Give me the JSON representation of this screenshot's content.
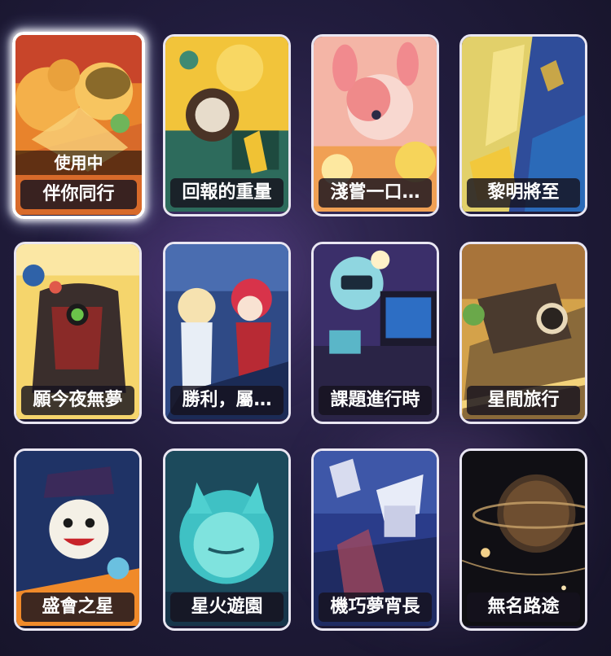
{
  "cards": [
    {
      "title": "伴你同行",
      "status": "使用中",
      "selected": true
    },
    {
      "title": "回報的重量"
    },
    {
      "title": "淺嘗一口…"
    },
    {
      "title": "黎明將至"
    },
    {
      "title": "願今夜無夢"
    },
    {
      "title": "勝利，屬…"
    },
    {
      "title": "課題進行時"
    },
    {
      "title": "星間旅行"
    },
    {
      "title": "盛會之星"
    },
    {
      "title": "星火遊園"
    },
    {
      "title": "機巧夢宵長"
    },
    {
      "title": "無名路途"
    }
  ]
}
